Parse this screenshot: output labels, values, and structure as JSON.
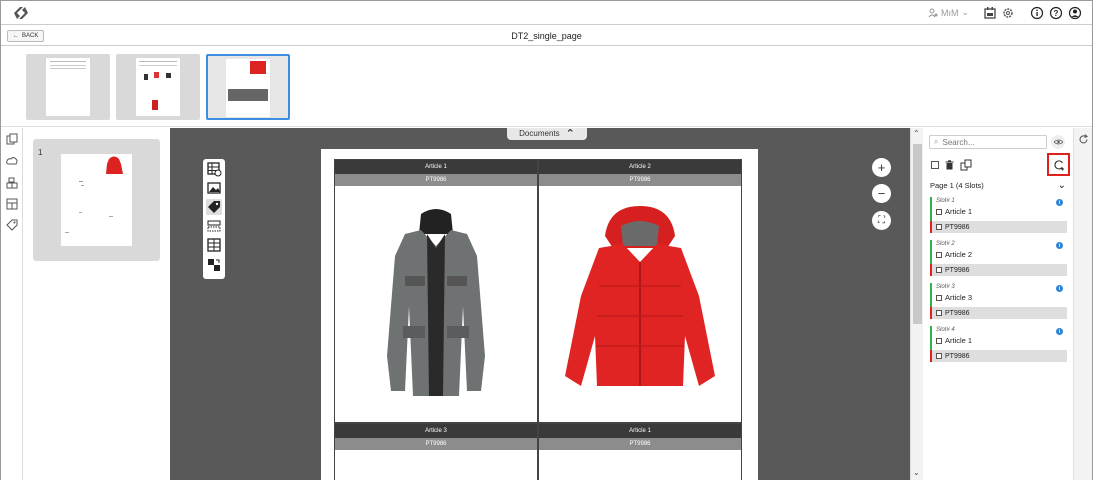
{
  "header": {
    "user_label": "MıM",
    "icons": [
      "logo-icon",
      "user-gear-icon",
      "calendar-icon",
      "settings-icon",
      "info-icon",
      "help-icon",
      "account-icon"
    ]
  },
  "titlebar": {
    "back_label": "BACK",
    "document_title": "DT2_single_page"
  },
  "canvas": {
    "documents_tab_label": "Documents",
    "slots": [
      {
        "title": "Article 1",
        "code": "PT9986",
        "jacket": "grey"
      },
      {
        "title": "Article 2",
        "code": "PT9986",
        "jacket": "red"
      },
      {
        "title": "Article 3",
        "code": "PT9986",
        "jacket": "grey"
      },
      {
        "title": "Article 1",
        "code": "PT9986",
        "jacket": "grey"
      }
    ]
  },
  "page_panel": {
    "page_number": "1"
  },
  "right_panel": {
    "search_placeholder": "Search...",
    "page_header": "Page 1 (4 Slots)",
    "slots": [
      {
        "label": "Slot# 1",
        "article": "Article 1",
        "code": "PT9986"
      },
      {
        "label": "Slot# 2",
        "article": "Article 2",
        "code": "PT9986"
      },
      {
        "label": "Slot# 3",
        "article": "Article 3",
        "code": "PT9986"
      },
      {
        "label": "Slot# 4",
        "article": "Article 1",
        "code": "PT9986"
      }
    ]
  },
  "colors": {
    "accent": "#3b8ede",
    "slot_green": "#2fb34a",
    "highlight_red": "#e0201f",
    "canvas_bg": "#595959"
  }
}
